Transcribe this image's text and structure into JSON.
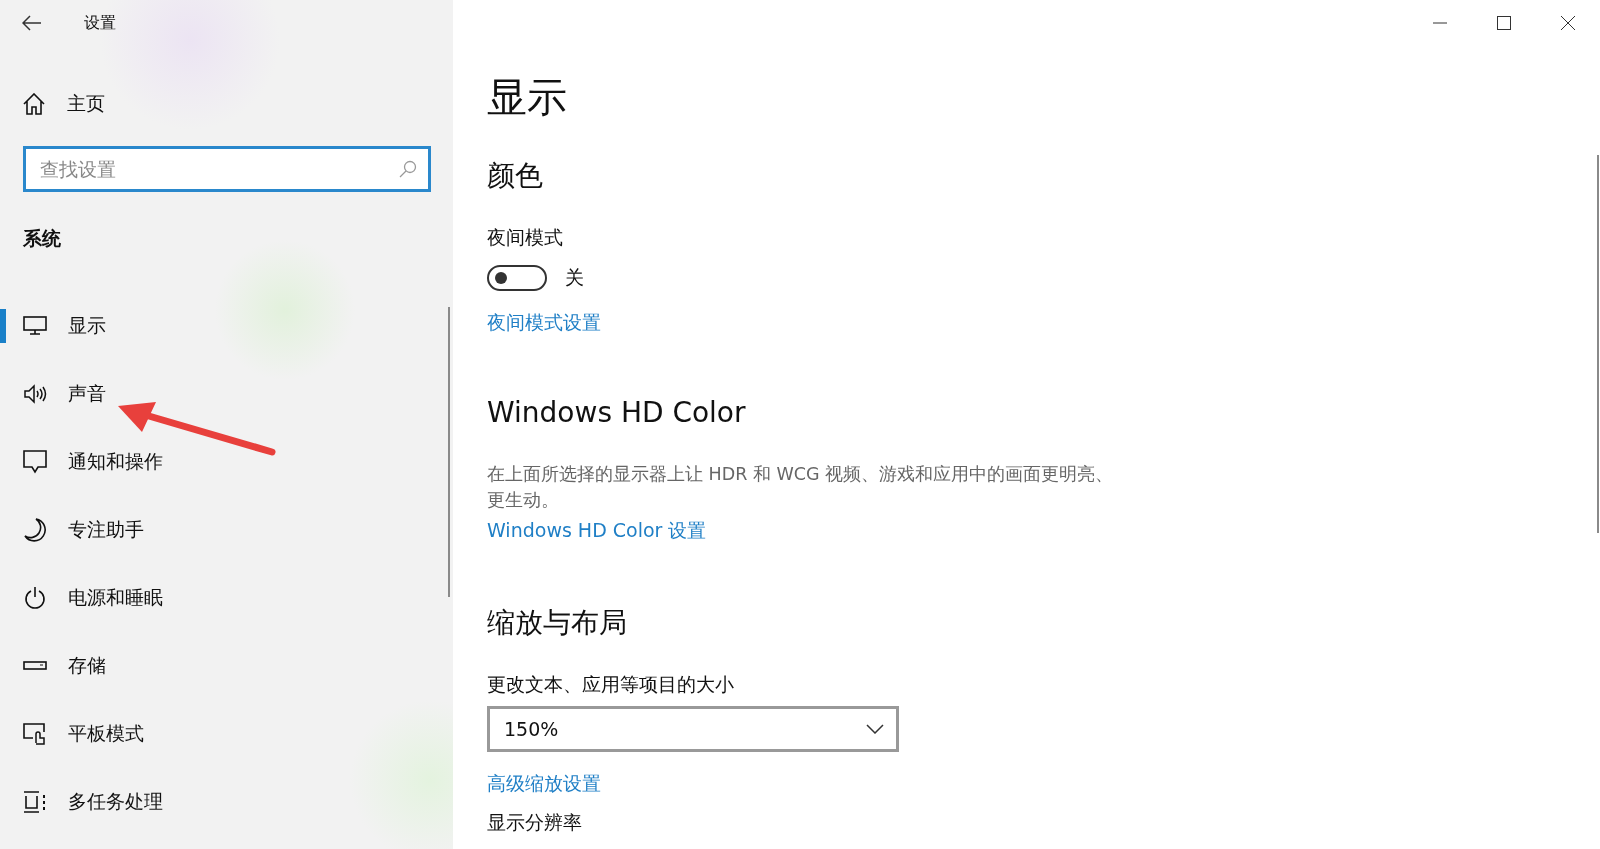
{
  "window": {
    "title": "设置"
  },
  "sidebar": {
    "home": "主页",
    "search": {
      "placeholder": "查找设置"
    },
    "section": "系统",
    "items": [
      {
        "label": "显示",
        "kind": "monitor",
        "selected": true
      },
      {
        "label": "声音",
        "kind": "speaker",
        "selected": false
      },
      {
        "label": "通知和操作",
        "kind": "message",
        "selected": false
      },
      {
        "label": "专注助手",
        "kind": "moon",
        "selected": false
      },
      {
        "label": "电源和睡眠",
        "kind": "power",
        "selected": false
      },
      {
        "label": "存储",
        "kind": "drive",
        "selected": false
      },
      {
        "label": "平板模式",
        "kind": "tablet",
        "selected": false
      },
      {
        "label": "多任务处理",
        "kind": "multitask",
        "selected": false
      }
    ]
  },
  "annotation": {
    "kind": "arrow"
  },
  "page": {
    "title": "显示",
    "sections": [
      {
        "heading": "颜色",
        "items": [
          {
            "kind": "toggle",
            "label": "夜间模式",
            "on": false,
            "state_text": "关"
          },
          {
            "kind": "link",
            "text": "夜间模式设置"
          }
        ]
      },
      {
        "heading": "Windows HD Color",
        "items": [
          {
            "kind": "description",
            "text": "在上面所选择的显示器上让 HDR 和 WCG 视频、游戏和应用中的画面更明亮、更生动。"
          },
          {
            "kind": "link",
            "text": "Windows HD Color 设置"
          }
        ]
      },
      {
        "heading": "缩放与布局",
        "items": [
          {
            "kind": "dropdown",
            "label": "更改文本、应用等项目的大小",
            "value": "150%"
          },
          {
            "kind": "link",
            "text": "高级缩放设置"
          },
          {
            "kind": "label",
            "text": "显示分辨率"
          }
        ]
      }
    ]
  }
}
